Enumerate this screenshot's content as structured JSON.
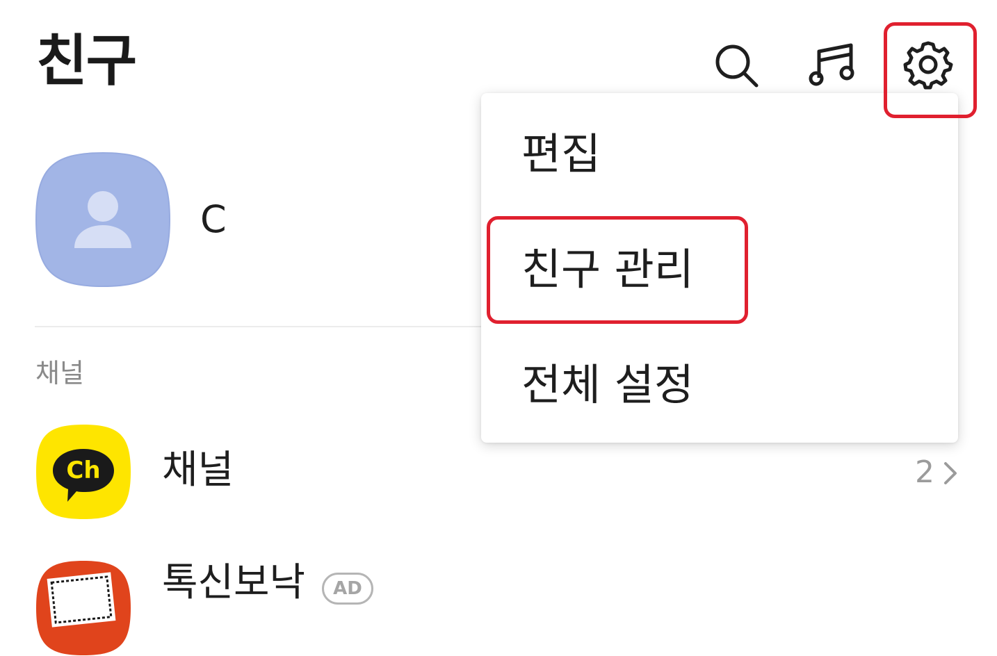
{
  "header": {
    "title": "친구",
    "icons": [
      "search-icon",
      "music-icon",
      "settings-gear-icon"
    ]
  },
  "profile": {
    "name": "C"
  },
  "channels_section": {
    "label": "채널",
    "items": [
      {
        "label": "채널",
        "count": "2",
        "icon": "kakao-channel-icon"
      },
      {
        "label": "톡신보낙",
        "badge": "AD",
        "icon": "promo-app-icon"
      }
    ]
  },
  "settings_menu": {
    "items": [
      {
        "label": "편집"
      },
      {
        "label": "친구 관리"
      },
      {
        "label": "전체 설정"
      }
    ]
  },
  "colors": {
    "avatar_bg": "#a2b5e6",
    "avatar_figure": "#d6def5",
    "channel_yellow": "#fee500",
    "highlight_red": "#e0202f",
    "promo_red": "#e0441c"
  }
}
